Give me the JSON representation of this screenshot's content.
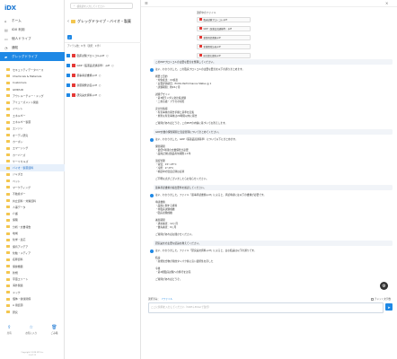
{
  "app": {
    "logo": "iDX"
  },
  "sidebar": {
    "nav": [
      {
        "label": "ホーム",
        "icon": "home-icon"
      },
      {
        "label": "iDX 利用",
        "icon": "chart-icon"
      },
      {
        "label": "個人ドライブ",
        "icon": "drive-icon"
      },
      {
        "label": "通知",
        "icon": "bell-icon"
      },
      {
        "label": "グレッグドライブ",
        "icon": "folder-icon"
      }
    ],
    "folders": [
      "セキュリティデータベース",
      "Chemicals & Materials",
      "Customers",
      "GMP/LIR",
      "アウトルーチャー・ドッグ",
      "アミューズメント関連",
      "イベント",
      "エネルギー",
      "エネルギー製薬",
      "エンジン",
      "オーディ研究",
      "カーボン",
      "エマージング",
      "カーバーズ",
      "ケーミカルズ",
      "バイオ・製薬資料",
      "ジャズロ",
      "ペット",
      "マーケティング",
      "不動産ポー",
      "共立資料・対策資料",
      "人事データ",
      "介護",
      "保険",
      "分析・文書報告",
      "地域",
      "化学・反応",
      "保育アイデア",
      "化粧・メディア",
      "名称資料",
      "保健機器",
      "新規",
      "宇宙エリート",
      "海外関連",
      "ドック",
      "個体・健康関係",
      "A 用資源",
      "研究"
    ],
    "actions": [
      {
        "label": "共有",
        "icon": "share-icon"
      },
      {
        "label": "お気に入り",
        "icon": "star-icon"
      },
      {
        "label": "ごみ箱",
        "icon": "trash-icon"
      }
    ],
    "copyright": "Copyright©2024 iDX Inc.\n(ver.1.0)"
  },
  "middle": {
    "search_placeholder": "検索語を入力してください",
    "title": "グレッグドライブ・バイオ・製薬",
    "meta": "アイテム数：8 件（選択：0 件）",
    "files": [
      {
        "name": "臨床試験プロトコル.pdf",
        "checked": true
      },
      {
        "name": "GDP（医薬品流通基準）.pdf",
        "checked": true
      },
      {
        "name": "薬事承認書類.pdf",
        "checked": true
      },
      {
        "name": "新薬開発計画.pdf",
        "checked": true
      },
      {
        "name": "研究論文資料.pdf",
        "checked": true
      }
    ]
  },
  "chat": {
    "refs_label": "選択中のファイル",
    "refs": [
      "臨床試験プロトコル.pdf",
      "GDP（医薬品流通基準）.pdf",
      "薬事承認書類.pdf",
      "新薬開発計画.pdf",
      "研究論文資料.pdf"
    ],
    "messages": [
      {
        "kind": "bubble",
        "text": "このPDFプロトコルの主要な要点を整理してください。"
      },
      {
        "kind": "bot",
        "lines": [
          "はい、わかりました。この臨床プロトコルの主要な要点を以下の通りまとめます。",
          "",
          "概要と目的",
          "・対象疾患：XX疾患",
          "・主要評価項目：ECOG Performance Status ≦ 1",
          "・試験期間：約24ヶ月",
          "",
          "試験デザイン",
          "・第3相ランダム化比較試験",
          "・二重盲検・プラセボ対照",
          "",
          "安全性情報",
          "・有害事象の報告手順と基準を定義",
          "・重篤な有害事象は24時間以内に報告",
          "",
          "ご質問があればどうぞ。このPDFの内容に基づいてお答えします。"
        ]
      },
      {
        "kind": "bubble",
        "text": "GDP文書の保管期間と温度管理についてまとめてください。"
      },
      {
        "kind": "bot",
        "lines": [
          "はい、わかりました。GDP（医薬品流通基準）について以下にまとめます。",
          "",
          "保管期間",
          "・最低5年間の文書保管が必要",
          "・品質記録は製品有効期限＋1年",
          "",
          "温度管理",
          "・常温：15〜25°C",
          "・冷所：2〜8°C",
          "・輸送中の温度記録は必須",
          "",
          "ご不明な点がございましたらお知らせください。"
        ]
      },
      {
        "kind": "bubble",
        "text": "薬事承認書類の提出要件を確認してください。"
      },
      {
        "kind": "bot",
        "lines": [
          "はい、わかりました。ファイル「薬事承認書類.pdf」によると、承認申請には以下の書類が必要です。",
          "",
          "申請書類",
          "・品質に関する資料",
          "・非臨床試験成績",
          "・臨床試験成績",
          "",
          "審査期間",
          "・通常審査：12ヶ月",
          "・優先審査：9ヶ月",
          "",
          "ご質問があればお聞かせください。"
        ]
      },
      {
        "kind": "bubble",
        "text": "研究論文の主要な結論を教えてください。"
      },
      {
        "kind": "bot",
        "lines": [
          "はい、わかりました。ファイル「研究論文資料.pdf」によると、主な結論は以下の通りです。",
          "",
          "結論",
          "・新規化合物が標的タンパク質に高い選択性を示した",
          "",
          "今後",
          "・第2相臨床試験への移行を計画",
          "",
          "ご質問があればどうぞ。"
        ]
      }
    ],
    "select_label": "選択済み：",
    "select_link": "7ファイル",
    "checkbox_label": "チャット文字数",
    "input_placeholder": "ここに質問を入力してください（Shift＋Enterで改行）",
    "send_icon": "send-icon",
    "settings_icon": "gear-icon"
  }
}
